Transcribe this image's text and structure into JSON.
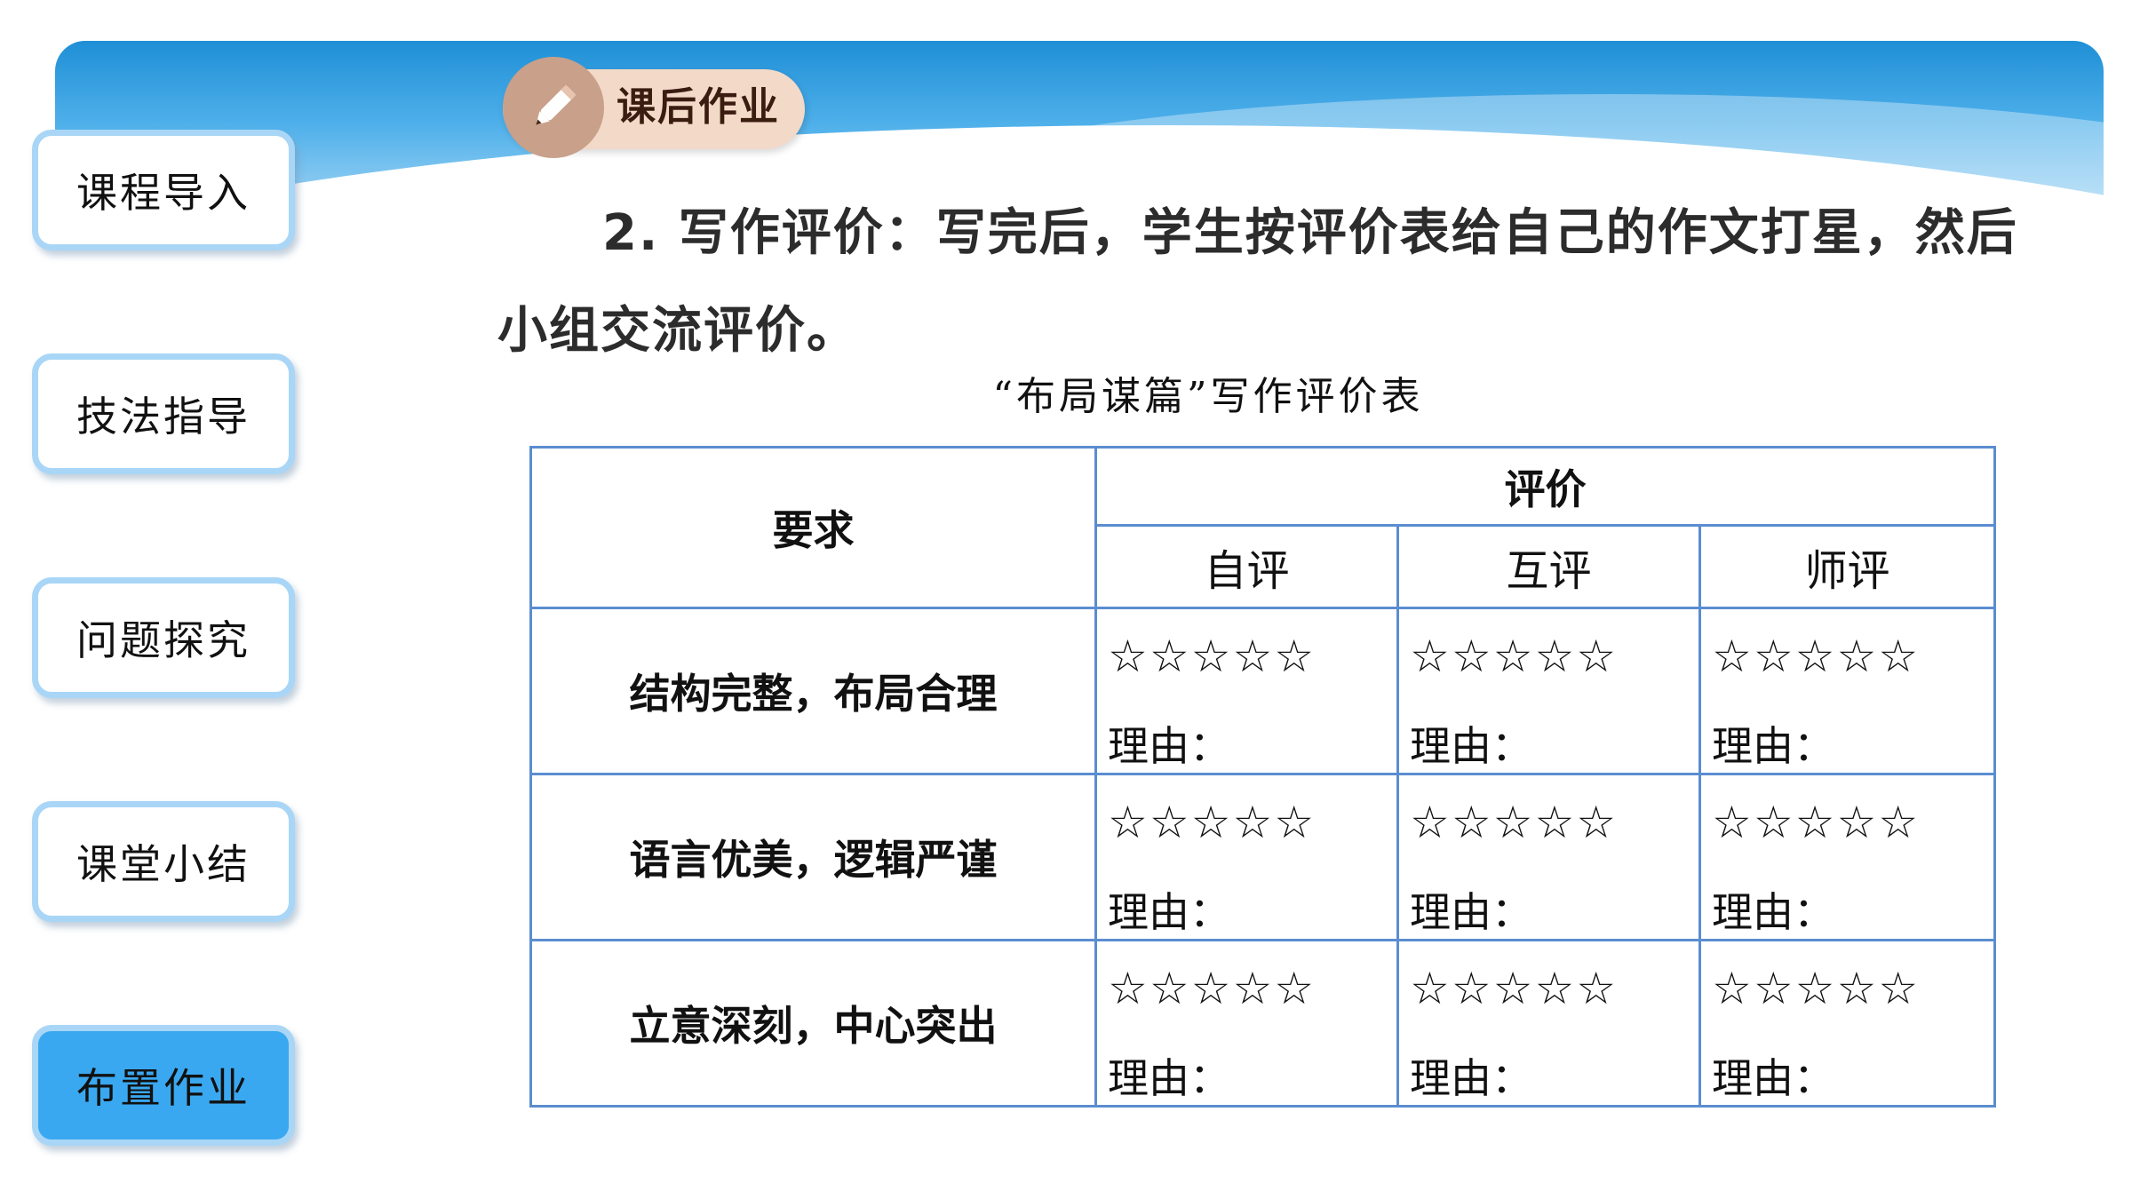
{
  "sidebar": {
    "items": [
      {
        "label": "课程导入",
        "active": false
      },
      {
        "label": "技法指导",
        "active": false
      },
      {
        "label": "问题探究",
        "active": false
      },
      {
        "label": "课堂小结",
        "active": false
      },
      {
        "label": "布置作业",
        "active": true
      }
    ]
  },
  "header": {
    "tag_label": "课后作业"
  },
  "task": {
    "number": "2.",
    "text": "写作评价：写完后，学生按评价表给自己的作文打星，然后小组交流评价。"
  },
  "table": {
    "title": "“布局谋篇”写作评价表",
    "col_requirement": "要求",
    "col_evaluation": "评价",
    "sub_headers": [
      "自评",
      "互评",
      "师评"
    ],
    "stars": "☆☆☆☆☆",
    "reason_label": "理由：",
    "rows": [
      {
        "requirement": "结构完整，布局合理"
      },
      {
        "requirement": "语言优美，逻辑严谨"
      },
      {
        "requirement": "立意深刻，中心突出"
      }
    ]
  },
  "colors": {
    "accent": "#3aa8f0",
    "table_border": "#5b8dd0",
    "tag_bg": "#f3d9c8"
  }
}
